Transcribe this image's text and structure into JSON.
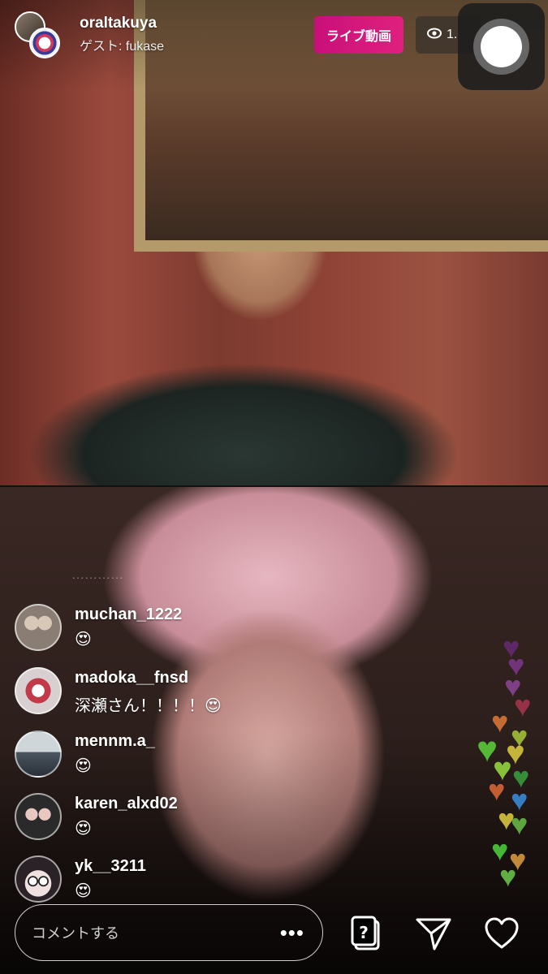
{
  "header": {
    "host_username": "oraltakuya",
    "guest_label": "ゲスト: fukase",
    "live_badge": "ライブ動画",
    "viewer_count": "1."
  },
  "faded_comment": "…………",
  "comments": [
    {
      "username": "muchan_1222",
      "message": "😍",
      "avatar_color": "#8a7d74"
    },
    {
      "username": "madoka__fnsd",
      "message": "深瀬さん！！！！😍",
      "avatar_color": "#c9c2c2"
    },
    {
      "username": "mennm.a_",
      "message": "😍",
      "avatar_color": "#5d6a74"
    },
    {
      "username": "karen_alxd02",
      "message": "😍",
      "avatar_color": "#3a3a3a"
    },
    {
      "username": "yk__3211",
      "message": "😍",
      "avatar_color": "#8a6b72"
    }
  ],
  "composer": {
    "placeholder": "コメントする",
    "more_label": "•••"
  },
  "icons": [
    "question-card-icon",
    "send-icon",
    "heart-icon",
    "eye-icon",
    "assistive-touch-icon"
  ],
  "colors": {
    "live_badge": "#d4147c",
    "heart_colors": [
      "#7a3a8a",
      "#9a3a8a",
      "#8a4aa0",
      "#e07a3a",
      "#6ac04a",
      "#4ac83a",
      "#e0d040",
      "#3aa0e0",
      "#9ae040",
      "#e06a3a"
    ]
  }
}
